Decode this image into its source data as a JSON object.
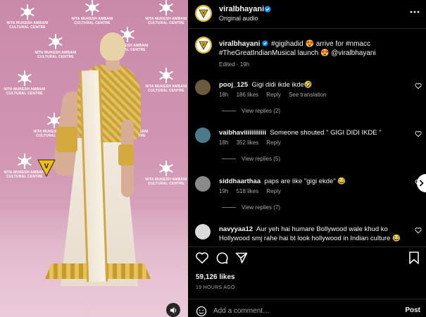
{
  "media": {
    "backdrop_text": "NITA MUKESH AMBANI CULTURAL CENTRE",
    "watermark_letter": "V",
    "mute_icon": "speaker-icon"
  },
  "header": {
    "username": "viralbhayani",
    "audio": "Original audio",
    "more_icon": "more-icon"
  },
  "caption": {
    "username": "viralbhayani",
    "text": " #gigihadid 😍 arrive for #nmacc #TheGreatIndianMusical launch 😍 @viralbhayani",
    "meta": "Edited · 19h"
  },
  "comments": [
    {
      "username": "pooj_125",
      "text": "Gigi didi ikde ikde🤣",
      "time": "18h",
      "likes": "186 likes",
      "reply": "Reply",
      "extra": "See translation",
      "replies": "View replies (2)",
      "avatar_color": "#6b5a3e"
    },
    {
      "username": "vaibhaviiiiiiiiiiii",
      "text": "Someone shouted \" GIGI DIDI IKDE \"",
      "time": "18h",
      "likes": "352 likes",
      "reply": "Reply",
      "extra": "",
      "replies": "View replies (5)",
      "avatar_color": "#4d7a8a"
    },
    {
      "username": "siddhaarthaa",
      "text": "paps are like \"gigi ekde\" 😂",
      "time": "19h",
      "likes": "518 likes",
      "reply": "Reply",
      "extra": "",
      "replies": "View replies (7)",
      "avatar_color": "#8a8a8a"
    },
    {
      "username": "navyyaa12",
      "text": "Aur yeh hai humare Bollywood wale khud ko Hollywood smj rahe hai bt look hollywood in Indian culture 😂",
      "time": "",
      "likes": "",
      "reply": "",
      "extra": "",
      "replies": "",
      "avatar_color": "#dbdbdb"
    }
  ],
  "actions": {
    "like_icon": "heart-icon",
    "comment_icon": "comment-icon",
    "share_icon": "send-icon",
    "save_icon": "bookmark-icon"
  },
  "likes": "59,126 likes",
  "time_ago": "19 HOURS AGO",
  "comment_box": {
    "placeholder": "Add a comment…",
    "post_label": "Post",
    "emoji_icon": "emoji-icon"
  },
  "colors": {
    "background": "#000000",
    "text_primary": "#f5f5f5",
    "text_secondary": "#a8a8a8",
    "verified_blue": "#0095f6",
    "brand_yellow": "#e0b100"
  }
}
